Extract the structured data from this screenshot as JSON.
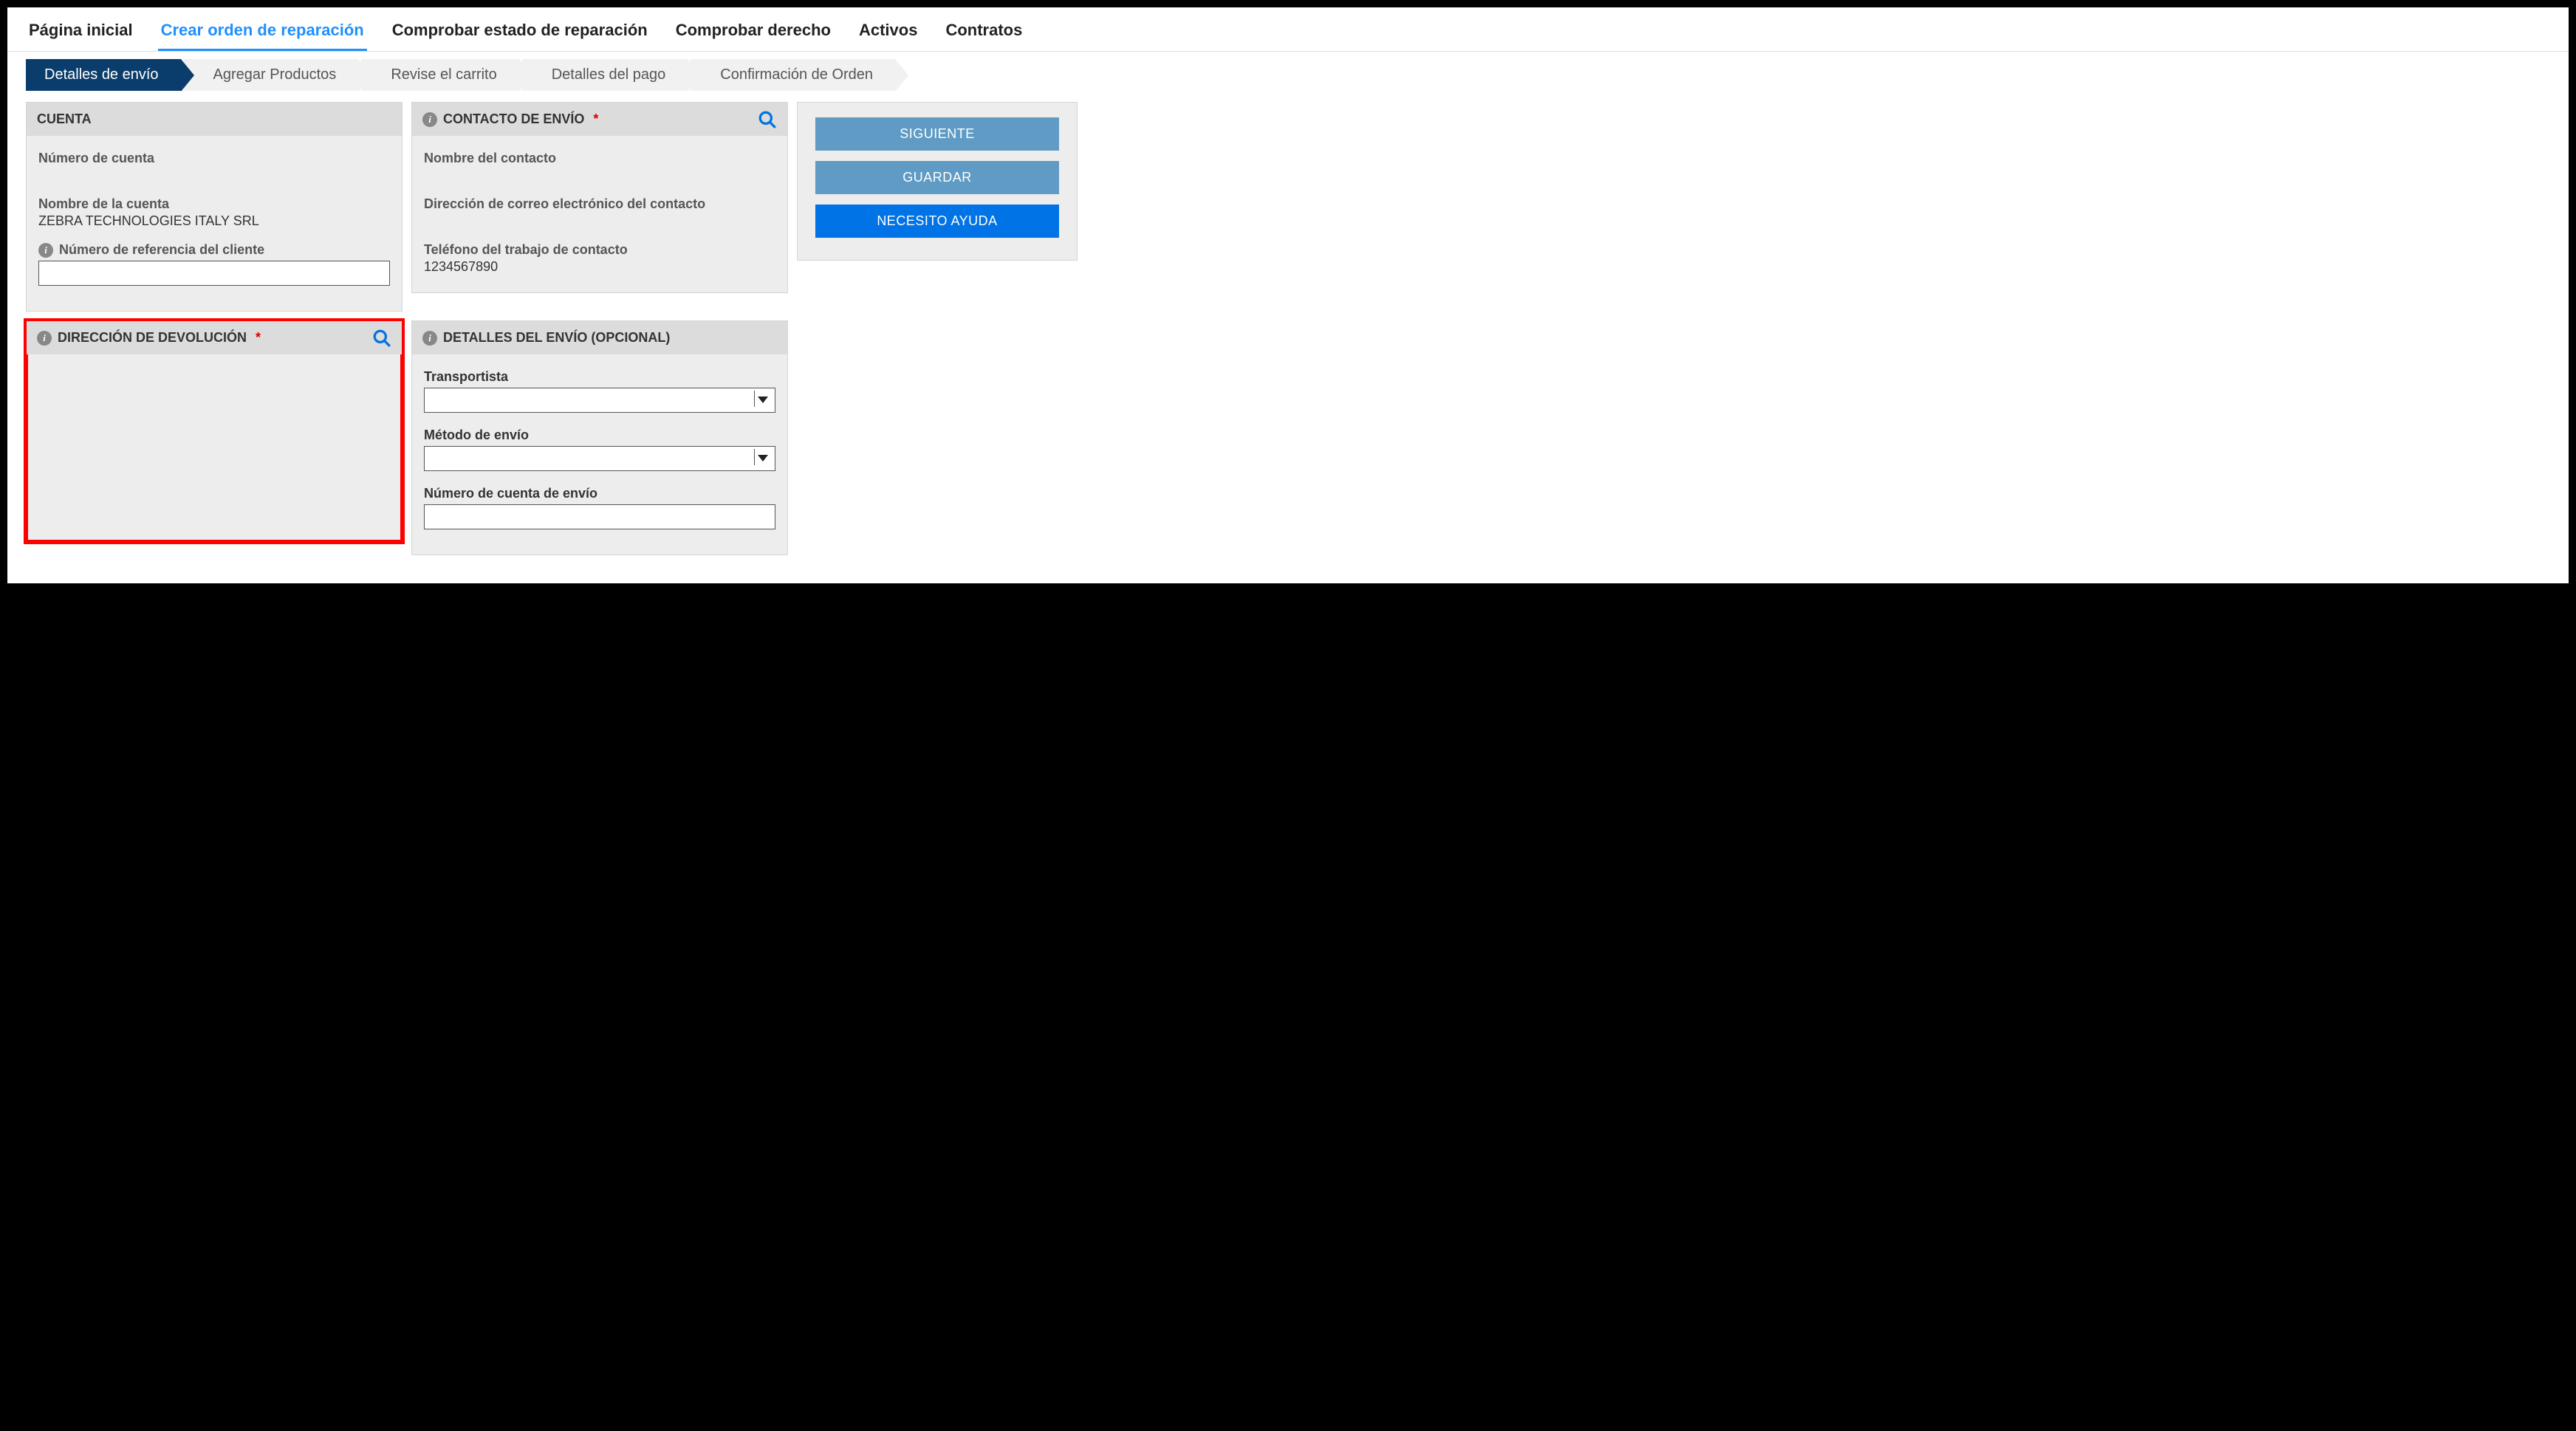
{
  "topnav": {
    "items": [
      {
        "label": "Página inicial"
      },
      {
        "label": "Crear orden de reparación",
        "active": true
      },
      {
        "label": "Comprobar estado de reparación"
      },
      {
        "label": "Comprobar derecho"
      },
      {
        "label": "Activos"
      },
      {
        "label": "Contratos"
      }
    ]
  },
  "wizard": {
    "steps": [
      {
        "label": "Detalles de envío",
        "current": true
      },
      {
        "label": "Agregar Productos"
      },
      {
        "label": "Revise el carrito"
      },
      {
        "label": "Detalles del pago"
      },
      {
        "label": "Confirmación de Orden"
      }
    ]
  },
  "account": {
    "title": "CUENTA",
    "number_label": "Número de cuenta",
    "number_value": "",
    "name_label": "Nombre de la cuenta",
    "name_value": "ZEBRA TECHNOLOGIES ITALY SRL",
    "ref_label": "Número de referencia del cliente",
    "ref_value": ""
  },
  "contact": {
    "title": "CONTACTO DE ENVÍO",
    "name_label": "Nombre del contacto",
    "name_value": "",
    "email_label": "Dirección de correo electrónico del contacto",
    "email_value": "",
    "phone_label": "Teléfono del trabajo de contacto",
    "phone_value": "1234567890"
  },
  "return_address": {
    "title": "DIRECCIÓN DE DEVOLUCIÓN"
  },
  "ship_details": {
    "title": "DETALLES DEL ENVÍO (OPCIONAL)",
    "carrier_label": "Transportista",
    "carrier_value": "",
    "method_label": "Método de envío",
    "method_value": "",
    "account_label": "Número de cuenta de envío",
    "account_value": ""
  },
  "actions": {
    "next": "SIGUIENTE",
    "save": "GUARDAR",
    "help": "NECESITO AYUDA"
  }
}
